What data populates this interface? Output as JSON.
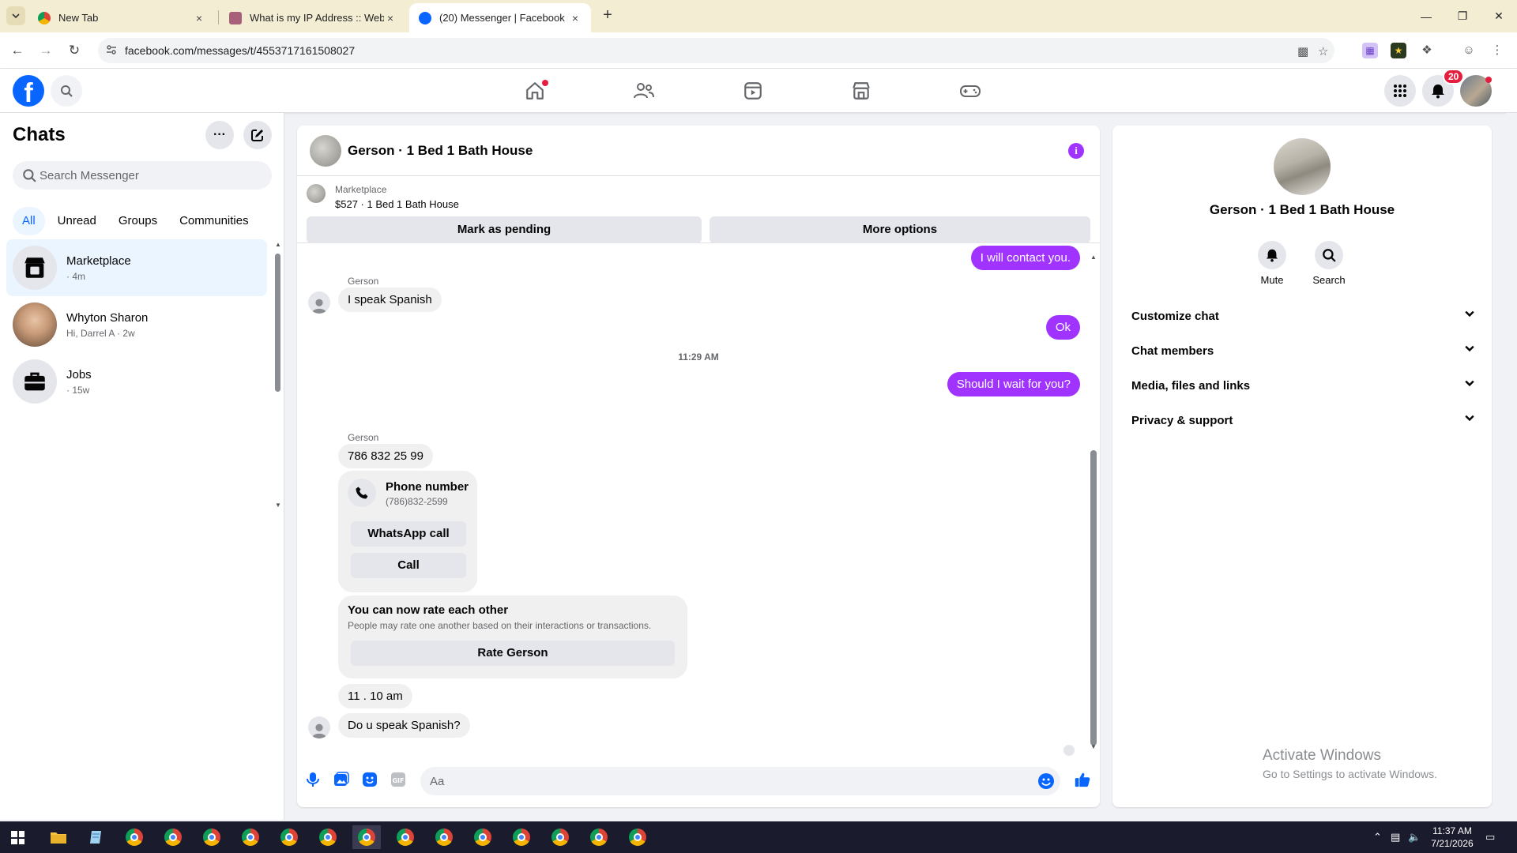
{
  "browser": {
    "tabs": [
      {
        "title": "New Tab",
        "active": false
      },
      {
        "title": "What is my IP Address :: WebBr",
        "active": false
      },
      {
        "title": "(20) Messenger | Facebook",
        "active": true
      }
    ],
    "url": "facebook.com/messages/t/4553717161508027",
    "close_glyph": "×"
  },
  "header": {
    "notification_count": "20",
    "home_has_dot": true
  },
  "chats": {
    "title": "Chats",
    "search_placeholder": "Search Messenger",
    "filters": [
      "All",
      "Unread",
      "Groups",
      "Communities"
    ],
    "items": [
      {
        "name": "Marketplace",
        "sub": "· 4m",
        "selected": true,
        "icon": "storefront-icon"
      },
      {
        "name": "Whyton Sharon",
        "sub": "Hi, Darrel A · 2w",
        "selected": false,
        "icon": "profile-photo"
      },
      {
        "name": "Jobs",
        "sub": "· 15w",
        "selected": false,
        "icon": "briefcase-icon"
      }
    ]
  },
  "conversation": {
    "title": "Gerson · 1 Bed 1 Bath House",
    "info_glyph": "i",
    "marketplace": {
      "label": "Marketplace",
      "item": "$527 · 1 Bed 1 Bath House",
      "mark_pending": "Mark as pending",
      "more_options": "More options"
    },
    "messages": {
      "out_1": "I will contact you.",
      "sender_1": "Gerson",
      "in_1": "I speak Spanish",
      "out_2": "Ok",
      "timestamp": "11:29 AM",
      "out_3": "Should I wait for you?",
      "sender_2": "Gerson",
      "in_2": "786 832 25 99",
      "phone_card": {
        "title": "Phone number",
        "number": "(786)832-2599",
        "whatsapp": "WhatsApp call",
        "call": "Call"
      },
      "rate_card": {
        "title": "You can now rate each other",
        "sub": "People may rate one another based on their interactions or transactions.",
        "button": "Rate Gerson"
      },
      "in_3": "11 . 10 am",
      "in_4": "Do u speak Spanish?"
    },
    "composer_placeholder": "Aa"
  },
  "info_panel": {
    "name": "Gerson · 1 Bed 1 Bath House",
    "actions": [
      {
        "label": "Mute",
        "icon": "bell-icon"
      },
      {
        "label": "Search",
        "icon": "search-icon"
      }
    ],
    "sections": [
      "Customize chat",
      "Chat members",
      "Media, files and links",
      "Privacy & support"
    ],
    "chevron": "⌄"
  },
  "watermark": {
    "line1": "Activate Windows",
    "line2": "Go to Settings to activate Windows."
  },
  "taskbar": {
    "time": "11:37 AM",
    "date": "7/21/2026"
  },
  "colors": {
    "accent": "#0866ff",
    "outgoing_bubble": "#a033ff",
    "badge": "#e41e3f"
  }
}
